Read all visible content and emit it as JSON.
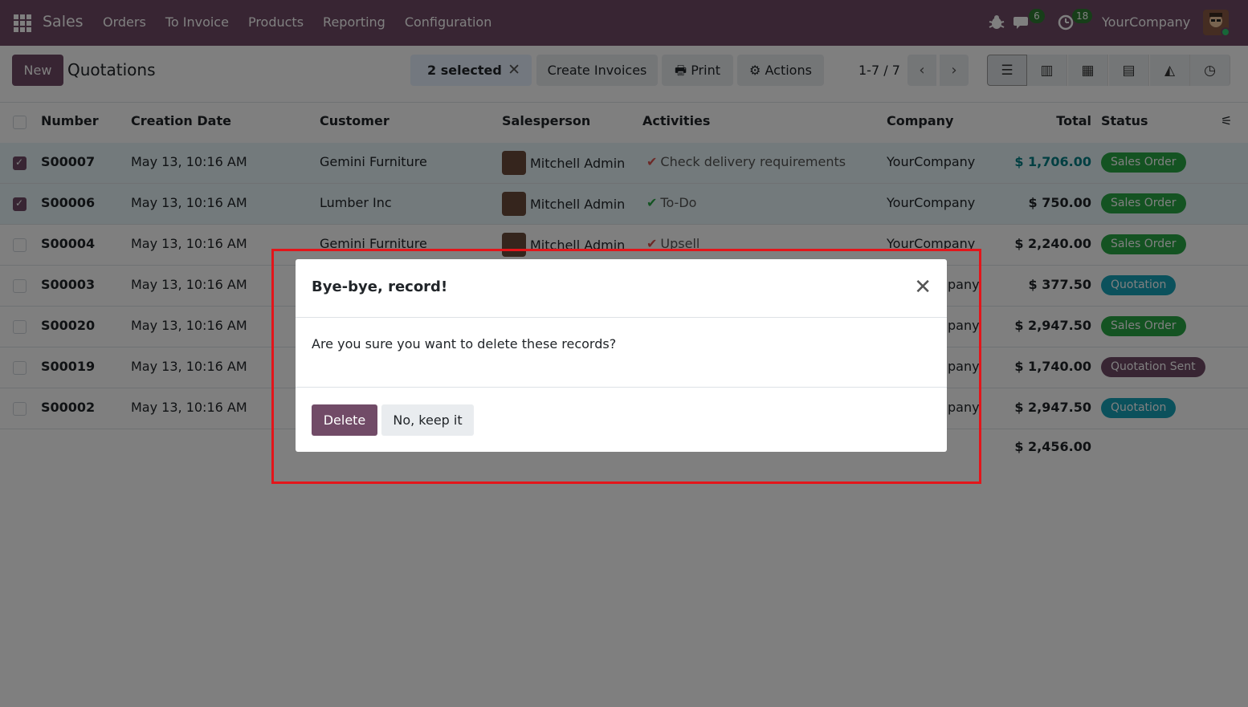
{
  "navbar": {
    "app_name": "Sales",
    "menu": [
      "Orders",
      "To Invoice",
      "Products",
      "Reporting",
      "Configuration"
    ],
    "chat_count": "6",
    "activity_count": "18",
    "company": "YourCompany",
    "bg_color": "#714b67"
  },
  "control": {
    "new_label": "New",
    "title": "Quotations",
    "selected_label": "2 selected",
    "create_invoices_label": "Create Invoices",
    "print_label": "Print",
    "actions_label": "Actions",
    "pager": "1-7 / 7"
  },
  "table": {
    "headers": [
      "Number",
      "Creation Date",
      "Customer",
      "Salesperson",
      "Activities",
      "Company",
      "Total",
      "Status"
    ],
    "rows": [
      {
        "number": "S00007",
        "date": "May 13, 10:16 AM",
        "customer": "Gemini Furniture",
        "salesperson": "Mitchell Admin",
        "activity": "Check delivery requirements",
        "activity_color": "red",
        "company": "YourCompany",
        "total": "$ 1,706.00",
        "status": "Sales Order",
        "selected": true
      },
      {
        "number": "S00006",
        "date": "May 13, 10:16 AM",
        "customer": "Lumber Inc",
        "salesperson": "Mitchell Admin",
        "activity": "To-Do",
        "activity_color": "green",
        "company": "YourCompany",
        "total": "$ 750.00",
        "status": "Sales Order",
        "selected": true
      },
      {
        "number": "S00004",
        "date": "May 13, 10:16 AM",
        "customer": "Gemini Furniture",
        "salesperson": "Mitchell Admin",
        "activity": "Upsell",
        "activity_color": "red",
        "company": "YourCompany",
        "total": "$ 2,240.00",
        "status": "Sales Order",
        "selected": false
      },
      {
        "number": "S00003",
        "date": "May 13, 10:16 AM",
        "customer": "",
        "salesperson": "",
        "activity": "",
        "activity_color": "",
        "company": "pany",
        "total": "$ 377.50",
        "status": "Quotation",
        "selected": false
      },
      {
        "number": "S00020",
        "date": "May 13, 10:16 AM",
        "customer": "",
        "salesperson": "",
        "activity": "",
        "activity_color": "",
        "company": "pany",
        "total": "$ 2,947.50",
        "status": "Sales Order",
        "selected": false
      },
      {
        "number": "S00019",
        "date": "May 13, 10:16 AM",
        "customer": "",
        "salesperson": "",
        "activity": "",
        "activity_color": "",
        "company": "pany",
        "total": "$ 1,740.00",
        "status": "Quotation Sent",
        "selected": false
      },
      {
        "number": "S00002",
        "date": "May 13, 10:16 AM",
        "customer": "",
        "salesperson": "",
        "activity": "",
        "activity_color": "",
        "company": "pany",
        "total": "$ 2,947.50",
        "status": "Quotation",
        "selected": false
      }
    ],
    "grand_total": "$ 2,456.00"
  },
  "status_colors": {
    "Sales Order": "#28a745",
    "Quotation": "#17a2b8",
    "Quotation Sent": "#714b67"
  },
  "modal": {
    "title": "Bye-bye, record!",
    "body": "Are you sure you want to delete these records?",
    "delete_label": "Delete",
    "keep_label": "No, keep it"
  },
  "highlight_color": "#e3151a"
}
